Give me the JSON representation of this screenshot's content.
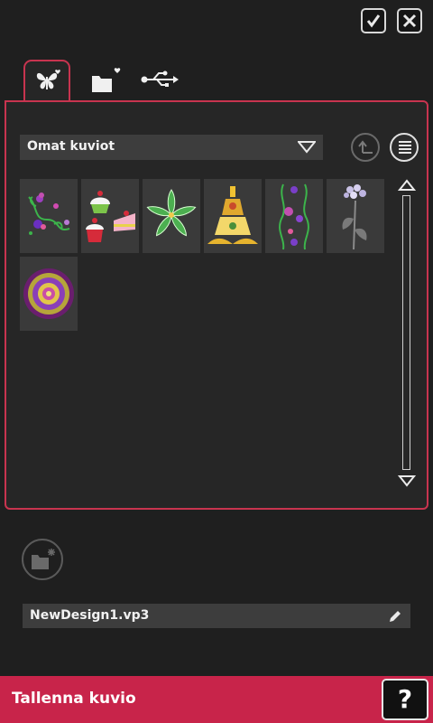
{
  "header": {
    "confirm_icon": "checkmark-icon",
    "close_icon": "close-x-icon"
  },
  "tabs": [
    {
      "icon": "butterfly-heart-icon",
      "active": true
    },
    {
      "icon": "folder-heart-icon",
      "active": false
    },
    {
      "icon": "usb-icon",
      "active": false
    }
  ],
  "browser": {
    "folder_select": {
      "value": "Omat kuviot"
    },
    "up_button_icon": "folder-up-icon",
    "list_view_icon": "list-view-icon",
    "thumbnails": [
      {
        "name": "floral-vine-embroidery"
      },
      {
        "name": "cupcakes-embroidery"
      },
      {
        "name": "green-leaf-star-embroidery"
      },
      {
        "name": "golden-ornament-embroidery"
      },
      {
        "name": "purple-floral-border-embroidery"
      },
      {
        "name": "lilac-flower-embroidery"
      },
      {
        "name": "purple-mandala-embroidery"
      }
    ]
  },
  "new_folder_icon": "new-folder-icon",
  "file": {
    "name": "NewDesign1.vp3",
    "edit_icon": "pencil-icon"
  },
  "footer": {
    "title": "Tallenna kuvio",
    "help_label": "?"
  },
  "colors": {
    "accent": "#c8244a",
    "background": "#1f1f1f",
    "panel": "#262626"
  }
}
